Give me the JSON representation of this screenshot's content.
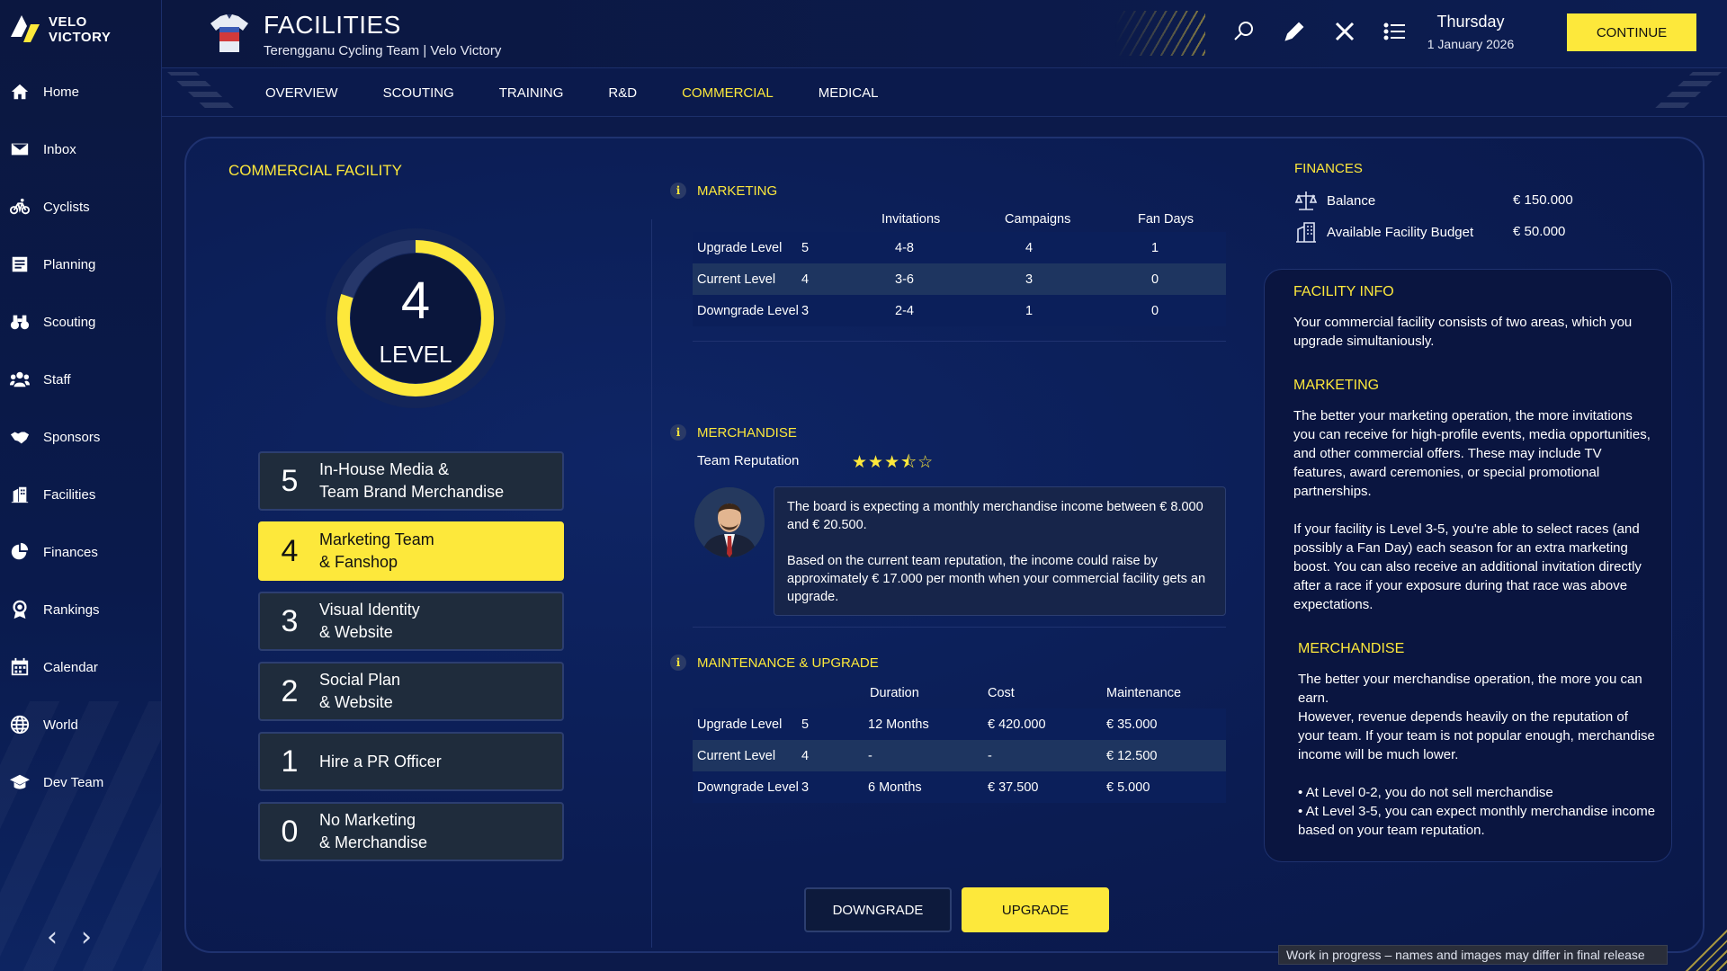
{
  "brand": {
    "line1": "VELO",
    "line2": "VICTORY"
  },
  "sidebar": {
    "items": [
      {
        "label": "Home",
        "icon": "home-icon"
      },
      {
        "label": "Inbox",
        "icon": "mail-icon"
      },
      {
        "label": "Cyclists",
        "icon": "bicycle-icon"
      },
      {
        "label": "Planning",
        "icon": "planning-icon"
      },
      {
        "label": "Scouting",
        "icon": "binoculars-icon"
      },
      {
        "label": "Staff",
        "icon": "staff-icon"
      },
      {
        "label": "Sponsors",
        "icon": "handshake-icon"
      },
      {
        "label": "Facilities",
        "icon": "building-icon"
      },
      {
        "label": "Finances",
        "icon": "pie-chart-icon"
      },
      {
        "label": "Rankings",
        "icon": "medal-icon"
      },
      {
        "label": "Calendar",
        "icon": "calendar-icon"
      },
      {
        "label": "World",
        "icon": "globe-icon"
      },
      {
        "label": "Dev Team",
        "icon": "graduation-cap-icon"
      }
    ],
    "prev_arrow": "‹",
    "next_arrow": "›"
  },
  "header": {
    "title": "FACILITIES",
    "subtitle": "Terengganu Cycling Team | Velo Victory",
    "day": "Thursday",
    "date": "1 January 2026",
    "continue_label": "CONTINUE"
  },
  "tabs": [
    {
      "label": "OVERVIEW",
      "active": false
    },
    {
      "label": "SCOUTING",
      "active": false
    },
    {
      "label": "TRAINING",
      "active": false
    },
    {
      "label": "R&D",
      "active": false
    },
    {
      "label": "COMMERCIAL",
      "active": true
    },
    {
      "label": "MEDICAL",
      "active": false
    }
  ],
  "facility": {
    "title": "COMMERCIAL FACILITY",
    "current_level": "4",
    "level_label": "LEVEL",
    "progress_fraction": 0.8,
    "levels": [
      {
        "num": "5",
        "desc": "In-House Media &\nTeam Brand Merchandise",
        "active": false
      },
      {
        "num": "4",
        "desc": "Marketing Team\n& Fanshop",
        "active": true
      },
      {
        "num": "3",
        "desc": "Visual Identity\n& Website",
        "active": false
      },
      {
        "num": "2",
        "desc": "Social Plan\n& Website",
        "active": false
      },
      {
        "num": "1",
        "desc": "Hire a PR Officer",
        "active": false
      },
      {
        "num": "0",
        "desc": "No Marketing\n& Merchandise",
        "active": false
      }
    ]
  },
  "marketing": {
    "title": "MARKETING",
    "headers": [
      "Invitations",
      "Campaigns",
      "Fan Days"
    ],
    "rows": [
      {
        "label": "Upgrade Level",
        "level": "5",
        "invitations": "4-8",
        "campaigns": "4",
        "fan_days": "1"
      },
      {
        "label": "Current Level",
        "level": "4",
        "invitations": "3-6",
        "campaigns": "3",
        "fan_days": "0"
      },
      {
        "label": "Downgrade Level",
        "level": "3",
        "invitations": "2-4",
        "campaigns": "1",
        "fan_days": "0"
      }
    ]
  },
  "merchandise": {
    "title": "MERCHANDISE",
    "reputation_label": "Team Reputation",
    "reputation_stars": 3.5,
    "board_text_1": "The board is expecting a monthly merchandise income between € 8.000 and € 20.500.",
    "board_text_2": "Based on the current team reputation, the income could raise by approximately € 17.000 per month when your commercial facility gets an upgrade."
  },
  "maintenance": {
    "title": "MAINTENANCE & UPGRADE",
    "headers": [
      "Duration",
      "Cost",
      "Maintenance"
    ],
    "rows": [
      {
        "label": "Upgrade Level",
        "level": "5",
        "duration": "12 Months",
        "cost": "€ 420.000",
        "maintenance": "€ 35.000"
      },
      {
        "label": "Current Level",
        "level": "4",
        "duration": "-",
        "cost": "-",
        "maintenance": "€ 12.500"
      },
      {
        "label": "Downgrade Level",
        "level": "3",
        "duration": "6 Months",
        "cost": "€ 37.500",
        "maintenance": "€ 5.000"
      }
    ]
  },
  "buttons": {
    "downgrade": "DOWNGRADE",
    "upgrade": "UPGRADE"
  },
  "finances": {
    "title": "FINANCES",
    "balance_label": "Balance",
    "balance_value": "€ 150.000",
    "budget_label": "Available Facility Budget",
    "budget_value": "€ 50.000"
  },
  "facility_info": {
    "title": "FACILITY INFO",
    "text": "Your commercial facility consists of two areas, which you upgrade simultaniously.",
    "marketing_title": "MARKETING",
    "marketing_text": "The better your marketing operation, the more invitations you can receive for high-profile events, media opportunities, and other commercial offers. These may include TV features, award ceremonies, or special promotional partnerships.\n\nIf your facility is Level 3-5, you're able to select races (and possibly a Fan Day) each season for an extra marketing boost. You can also receive an additional invitation directly after a race if your exposure during that race was above expectations.",
    "merch_title": "MERCHANDISE",
    "merch_text": "The better your merchandise operation, the more you can earn.\nHowever, revenue depends heavily on the reputation of your team. If your team is not popular enough, merchandise income will be much lower.\n\n• At Level 0-2, you do not sell merchandise\n• At Level 3-5, you can expect monthly merchandise income based on your team reputation."
  },
  "footer_note": "Work in progress – names and images may differ in final release",
  "colors": {
    "accent": "#fde83b",
    "bg": "#0c1a4a",
    "row_current": "#1e3560"
  }
}
